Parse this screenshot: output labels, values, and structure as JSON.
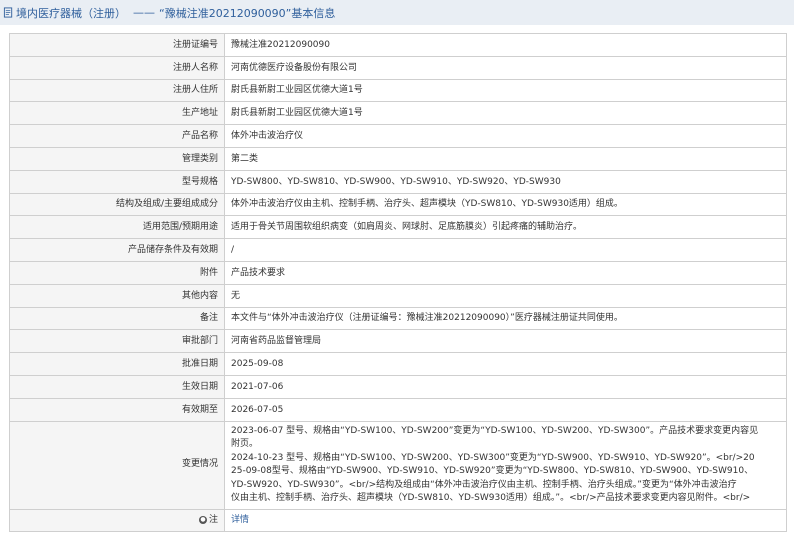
{
  "header": {
    "category": "境内医疗器械（注册）",
    "separator": "——",
    "title": "“豫械注准20212090090”基本信息"
  },
  "rows": [
    {
      "label": "注册证编号",
      "value": "豫械注准20212090090"
    },
    {
      "label": "注册人名称",
      "value": "河南优德医疗设备股份有限公司"
    },
    {
      "label": "注册人住所",
      "value": "尉氏县新尉工业园区优德大道1号"
    },
    {
      "label": "生产地址",
      "value": "尉氏县新尉工业园区优德大道1号"
    },
    {
      "label": "产品名称",
      "value": "体外冲击波治疗仪"
    },
    {
      "label": "管理类别",
      "value": "第二类"
    },
    {
      "label": "型号规格",
      "value": "YD-SW800、YD-SW810、YD-SW900、YD-SW910、YD-SW920、YD-SW930"
    },
    {
      "label": "结构及组成/主要组成成分",
      "value": "体外冲击波治疗仪由主机、控制手柄、治疗头、超声模块（YD-SW810、YD-SW930适用）组成。"
    },
    {
      "label": "适用范围/预期用途",
      "value": "适用于骨关节周围软组织病变（如肩周炎、网球肘、足底筋膜炎）引起疼痛的辅助治疗。"
    },
    {
      "label": "产品储存条件及有效期",
      "value": "/"
    },
    {
      "label": "附件",
      "value": "产品技术要求"
    },
    {
      "label": "其他内容",
      "value": "无"
    },
    {
      "label": "备注",
      "value": "本文件与“体外冲击波治疗仪（注册证编号：豫械注准20212090090）”医疗器械注册证共同使用。"
    },
    {
      "label": "审批部门",
      "value": "河南省药品监督管理局"
    },
    {
      "label": "批准日期",
      "value": "2025-09-08"
    },
    {
      "label": "生效日期",
      "value": "2021-07-06"
    },
    {
      "label": "有效期至",
      "value": "2026-07-05"
    }
  ],
  "change_row": {
    "label": "变更情况",
    "lines": [
      "2023-06-07 型号、规格由“YD-SW100、YD-SW200”变更为“YD-SW100、YD-SW200、YD-SW300”。产品技术要求变更内容见",
      "附页。",
      "2024-10-23 型号、规格由“YD-SW100、YD-SW200、YD-SW300”变更为“YD-SW900、YD-SW910、YD-SW920”。<br/>20",
      "25-09-08型号、规格由“YD-SW900、YD-SW910、YD-SW920”变更为“YD-SW800、YD-SW810、YD-SW900、YD-SW910、",
      "YD-SW920、YD-SW930”。<br/>结构及组成由“体外冲击波治疗仪由主机、控制手柄、治疗头组成。”变更为“体外冲击波治疗",
      "仪由主机、控制手柄、治疗头、超声模块（YD-SW810、YD-SW930适用）组成。”。<br/>产品技术要求变更内容见附件。<br/>"
    ]
  },
  "note_row": {
    "label": "注",
    "link": "详情"
  },
  "icons": {
    "header": "document-icon",
    "note": "info-icon"
  },
  "colors": {
    "header_bg": "#e9eef4",
    "title": "#2f5f9c",
    "label_bg": "#f5f5f5",
    "border": "#cfcfcf"
  }
}
